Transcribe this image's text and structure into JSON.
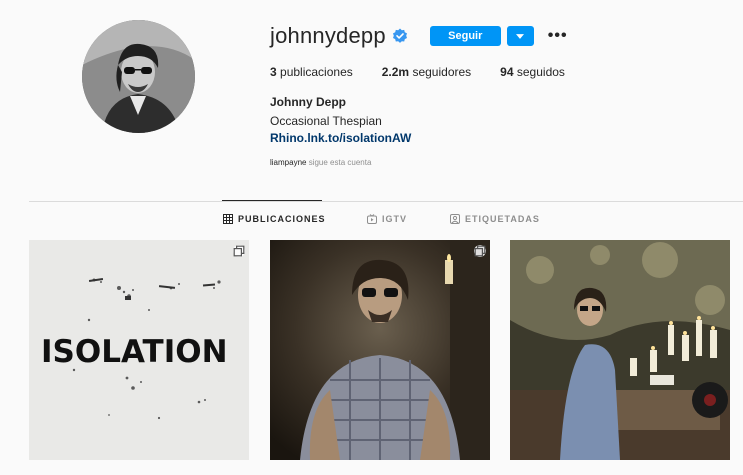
{
  "profile": {
    "username": "johnnydepp",
    "full_name": "Johnny Depp",
    "bio": "Occasional Thespian",
    "link": "Rhino.lnk.to/isolationAW",
    "follow_label": "Seguir",
    "followed_by_user": "liampayne",
    "followed_by_text": "sigue esta cuenta"
  },
  "stats": {
    "posts_count": "3",
    "posts_label": "publicaciones",
    "followers_count": "2.2m",
    "followers_label": "seguidores",
    "following_count": "94",
    "following_label": "seguidos"
  },
  "tabs": [
    {
      "label": "PUBLICACIONES",
      "icon": "grid-icon",
      "active": true
    },
    {
      "label": "IGTV",
      "icon": "igtv-icon",
      "active": false
    },
    {
      "label": "ETIQUETADAS",
      "icon": "tagged-icon",
      "active": false
    }
  ],
  "posts": [
    {
      "text": "ISOLATION",
      "multi": true
    },
    {
      "multi": true
    },
    {
      "multi": false
    }
  ],
  "colors": {
    "accent": "#0095f6",
    "link": "#00376b",
    "muted": "#8e8e8e",
    "background": "#fafafa",
    "divider": "#dbdbdb"
  }
}
